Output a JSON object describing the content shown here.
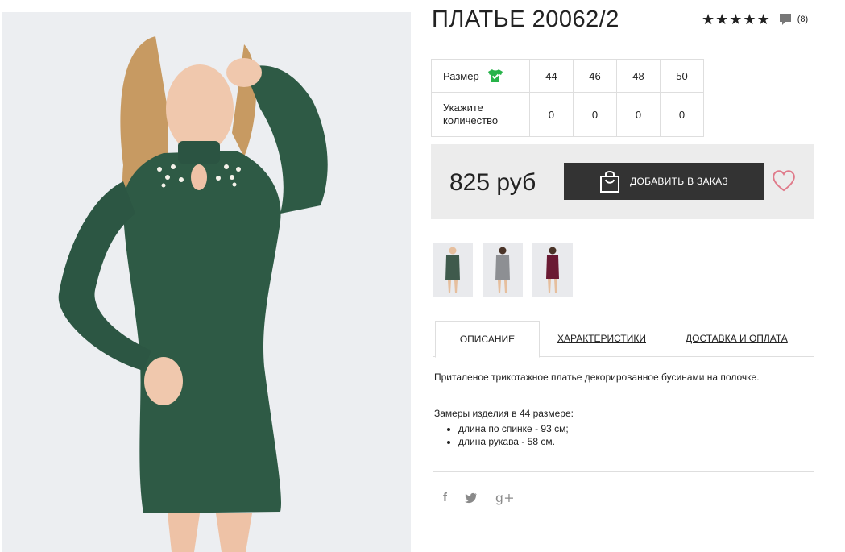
{
  "product": {
    "title": "ПЛАТЬЕ 20062/2",
    "rating_stars": 5,
    "rating_glyph": "★",
    "review_count": "(8)"
  },
  "sizes": {
    "size_label": "Размер",
    "qty_label": "Укажите количество",
    "values": [
      "44",
      "46",
      "48",
      "50"
    ],
    "quantities": [
      "0",
      "0",
      "0",
      "0"
    ]
  },
  "purchase": {
    "price": "825 руб",
    "add_button": "ДОБАВИТЬ В ЗАКАЗ"
  },
  "thumbnails": [
    {
      "color": "#3f5a4c"
    },
    {
      "color": "#8d8f93"
    },
    {
      "color": "#6a1a33"
    }
  ],
  "tabs": [
    {
      "label": "ОПИСАНИЕ"
    },
    {
      "label": "ХАРАКТЕРИСТИКИ"
    },
    {
      "label": "ДОСТАВКА И ОПЛАТА"
    }
  ],
  "description": {
    "text": "Приталеное трикотажное платье декорированное бусинами на полочке.",
    "measure_title": "Замеры изделия в 44 размере:",
    "items": [
      "длина по спинке - 93 см;",
      "длина рукава - 58 см."
    ]
  },
  "social": [
    "f",
    "tw",
    "g+"
  ],
  "colors": {
    "dress": "#2e5a45",
    "button_bg": "#333333",
    "heart": "#e07a8a",
    "shirt_icon": "#27b34a"
  }
}
